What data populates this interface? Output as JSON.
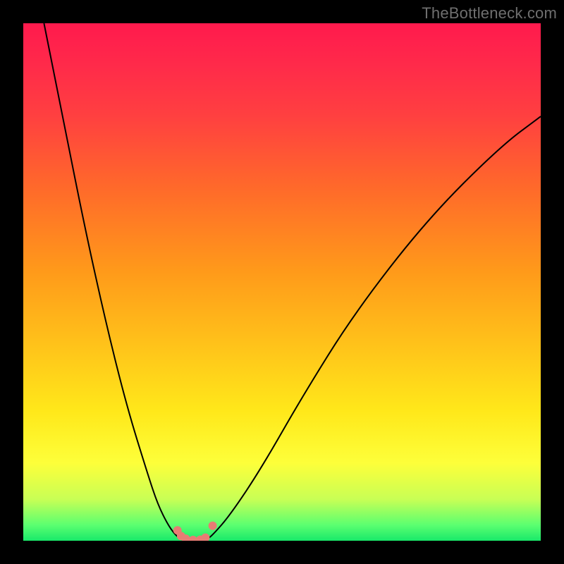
{
  "watermark": "TheBottleneck.com",
  "colors": {
    "frame": "#000000",
    "curve": "#000000",
    "dots": "#e77c74"
  },
  "chart_data": {
    "type": "line",
    "title": "",
    "xlabel": "",
    "ylabel": "",
    "xlim": [
      0,
      100
    ],
    "ylim": [
      0,
      100
    ],
    "grid": false,
    "legend": false,
    "note": "Axes unlabeled; values are approximate positions read from the figure in percentage units of the plot area; y=0 is bottom, y=100 is top.",
    "series": [
      {
        "name": "bottleneck-curve-left",
        "x": [
          4,
          8,
          12,
          16,
          20,
          24,
          26,
          28,
          29.5
        ],
        "y": [
          100,
          80,
          60,
          42,
          26,
          13,
          7,
          3,
          1
        ]
      },
      {
        "name": "bottleneck-curve-bottom",
        "x": [
          29.5,
          30.5,
          31.5,
          32.5,
          33.5,
          34.5,
          35.5,
          36.5
        ],
        "y": [
          1,
          0.3,
          0.1,
          0.05,
          0.05,
          0.1,
          0.3,
          1
        ]
      },
      {
        "name": "bottleneck-curve-right",
        "x": [
          36.5,
          40,
          46,
          54,
          64,
          78,
          92,
          100
        ],
        "y": [
          1,
          5,
          14,
          28,
          44,
          62,
          76,
          82
        ]
      }
    ],
    "points": [
      {
        "name": "dot",
        "x": 29.8,
        "y": 2.0
      },
      {
        "name": "dot",
        "x": 30.5,
        "y": 0.9
      },
      {
        "name": "dot",
        "x": 31.4,
        "y": 0.4
      },
      {
        "name": "dot",
        "x": 32.8,
        "y": 0.15
      },
      {
        "name": "dot",
        "x": 34.2,
        "y": 0.2
      },
      {
        "name": "dot",
        "x": 35.2,
        "y": 0.6
      },
      {
        "name": "dot",
        "x": 36.6,
        "y": 2.9
      }
    ],
    "background_gradient": {
      "type": "vertical",
      "stops": [
        {
          "pos": 0.0,
          "color": "#ff1a4d"
        },
        {
          "pos": 0.18,
          "color": "#ff4040"
        },
        {
          "pos": 0.48,
          "color": "#ff9a1a"
        },
        {
          "pos": 0.75,
          "color": "#ffe81a"
        },
        {
          "pos": 0.92,
          "color": "#c8ff55"
        },
        {
          "pos": 1.0,
          "color": "#19e96a"
        }
      ]
    }
  }
}
